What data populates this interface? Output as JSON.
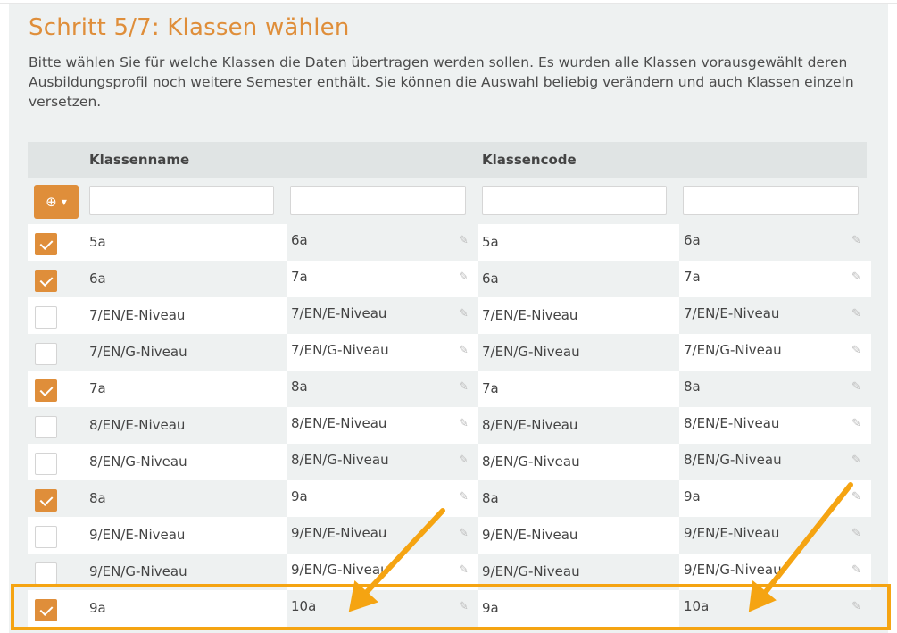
{
  "page": {
    "title": "Schritt 5/7: Klassen wählen",
    "description": "Bitte wählen Sie für welche Klassen die Daten übertragen werden sollen. Es wurden alle Klassen vorausgewählt deren Ausbildungsprofil noch weitere Semester enthält. Sie können die Auswahl beliebig verändern und auch Klassen einzeln versetzen."
  },
  "table": {
    "headers": {
      "name": "Klassenname",
      "code": "Klassencode"
    },
    "add_icon": "plus-circle-icon",
    "rows": [
      {
        "checked": true,
        "name": "5a",
        "target_name": "6a",
        "code": "5a",
        "target_code": "6a"
      },
      {
        "checked": true,
        "name": "6a",
        "target_name": "7a",
        "code": "6a",
        "target_code": "7a"
      },
      {
        "checked": false,
        "name": "7/EN/E-Niveau",
        "target_name": "7/EN/E-Niveau",
        "code": "7/EN/E-Niveau",
        "target_code": "7/EN/E-Niveau"
      },
      {
        "checked": false,
        "name": "7/EN/G-Niveau",
        "target_name": "7/EN/G-Niveau",
        "code": "7/EN/G-Niveau",
        "target_code": "7/EN/G-Niveau"
      },
      {
        "checked": true,
        "name": "7a",
        "target_name": "8a",
        "code": "7a",
        "target_code": "8a"
      },
      {
        "checked": false,
        "name": "8/EN/E-Niveau",
        "target_name": "8/EN/E-Niveau",
        "code": "8/EN/E-Niveau",
        "target_code": "8/EN/E-Niveau"
      },
      {
        "checked": false,
        "name": "8/EN/G-Niveau",
        "target_name": "8/EN/G-Niveau",
        "code": "8/EN/G-Niveau",
        "target_code": "8/EN/G-Niveau"
      },
      {
        "checked": true,
        "name": "8a",
        "target_name": "9a",
        "code": "8a",
        "target_code": "9a"
      },
      {
        "checked": false,
        "name": "9/EN/E-Niveau",
        "target_name": "9/EN/E-Niveau",
        "code": "9/EN/E-Niveau",
        "target_code": "9/EN/E-Niveau"
      },
      {
        "checked": false,
        "name": "9/EN/G-Niveau",
        "target_name": "9/EN/G-Niveau",
        "code": "9/EN/G-Niveau",
        "target_code": "9/EN/G-Niveau"
      },
      {
        "checked": true,
        "name": "9a",
        "target_name": "10a",
        "code": "9a",
        "target_code": "10a"
      }
    ]
  },
  "colors": {
    "accent": "#df8e3a",
    "annotation": "#f5a412"
  }
}
